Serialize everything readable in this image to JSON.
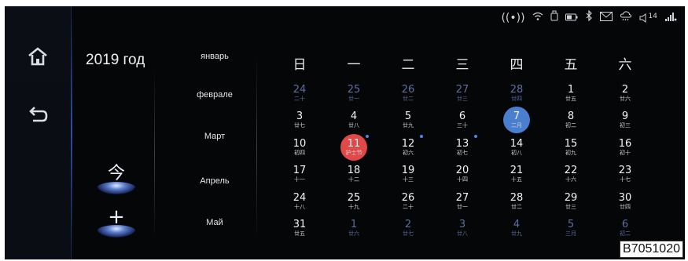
{
  "status_bar": {
    "icons": [
      "radio-signal-icon",
      "wifi-icon",
      "usb-icon",
      "battery-icon",
      "bluetooth-icon",
      "mail-icon",
      "weather-icon",
      "volume-icon",
      "cellular-icon"
    ],
    "volume_level": "14"
  },
  "nav": {
    "home_icon": "home-icon",
    "back_icon": "back-icon"
  },
  "year_label": "2019 год",
  "months": [
    "январь",
    "феврале",
    "Март",
    "Апрель",
    "Май"
  ],
  "actions": {
    "today": "今",
    "add": "+"
  },
  "weekdays": [
    "日",
    "一",
    "二",
    "三",
    "四",
    "五",
    "六"
  ],
  "weeks": [
    [
      {
        "n": "24",
        "l": "二十",
        "dim": true
      },
      {
        "n": "25",
        "l": "廿一",
        "dim": true
      },
      {
        "n": "26",
        "l": "廿二",
        "dim": true
      },
      {
        "n": "27",
        "l": "廿三",
        "dim": true
      },
      {
        "n": "28",
        "l": "廿四",
        "dim": true
      },
      {
        "n": "1",
        "l": "廿五"
      },
      {
        "n": "2",
        "l": "廿六"
      }
    ],
    [
      {
        "n": "3",
        "l": "廿七"
      },
      {
        "n": "4",
        "l": "廿八"
      },
      {
        "n": "5",
        "l": "廿九"
      },
      {
        "n": "6",
        "l": "三十"
      },
      {
        "n": "7",
        "l": "二月",
        "selected": true
      },
      {
        "n": "8",
        "l": "初二"
      },
      {
        "n": "9",
        "l": "初三"
      }
    ],
    [
      {
        "n": "10",
        "l": "初四"
      },
      {
        "n": "11",
        "l": "护士节",
        "today": true,
        "dot": true
      },
      {
        "n": "12",
        "l": "初六",
        "dot": true
      },
      {
        "n": "13",
        "l": "初七",
        "dot": true
      },
      {
        "n": "14",
        "l": "初八"
      },
      {
        "n": "15",
        "l": "初九"
      },
      {
        "n": "16",
        "l": "初十"
      }
    ],
    [
      {
        "n": "17",
        "l": "十一"
      },
      {
        "n": "18",
        "l": "十二"
      },
      {
        "n": "19",
        "l": "十三"
      },
      {
        "n": "20",
        "l": "十四"
      },
      {
        "n": "21",
        "l": "十五"
      },
      {
        "n": "22",
        "l": "十六"
      },
      {
        "n": "23",
        "l": "十七"
      }
    ],
    [
      {
        "n": "24",
        "l": "十八"
      },
      {
        "n": "25",
        "l": "十九"
      },
      {
        "n": "26",
        "l": "二十"
      },
      {
        "n": "27",
        "l": "廿一"
      },
      {
        "n": "28",
        "l": "廿二"
      },
      {
        "n": "29",
        "l": "廿三"
      },
      {
        "n": "30",
        "l": "廿四"
      }
    ],
    [
      {
        "n": "31",
        "l": "廿五"
      },
      {
        "n": "1",
        "l": "廿六",
        "dim": true
      },
      {
        "n": "2",
        "l": "廿七",
        "dim": true
      },
      {
        "n": "3",
        "l": "廿八",
        "dim": true
      },
      {
        "n": "4",
        "l": "廿九",
        "dim": true
      },
      {
        "n": "5",
        "l": "三月",
        "dim": true
      },
      {
        "n": "6",
        "l": "初二",
        "dim": true
      }
    ]
  ],
  "colors": {
    "today": "#e34848",
    "selected": "#4a7fd0",
    "dot": "#4a86e8",
    "dim_text": "#5d6fa0"
  },
  "figure_code": "B7051020"
}
